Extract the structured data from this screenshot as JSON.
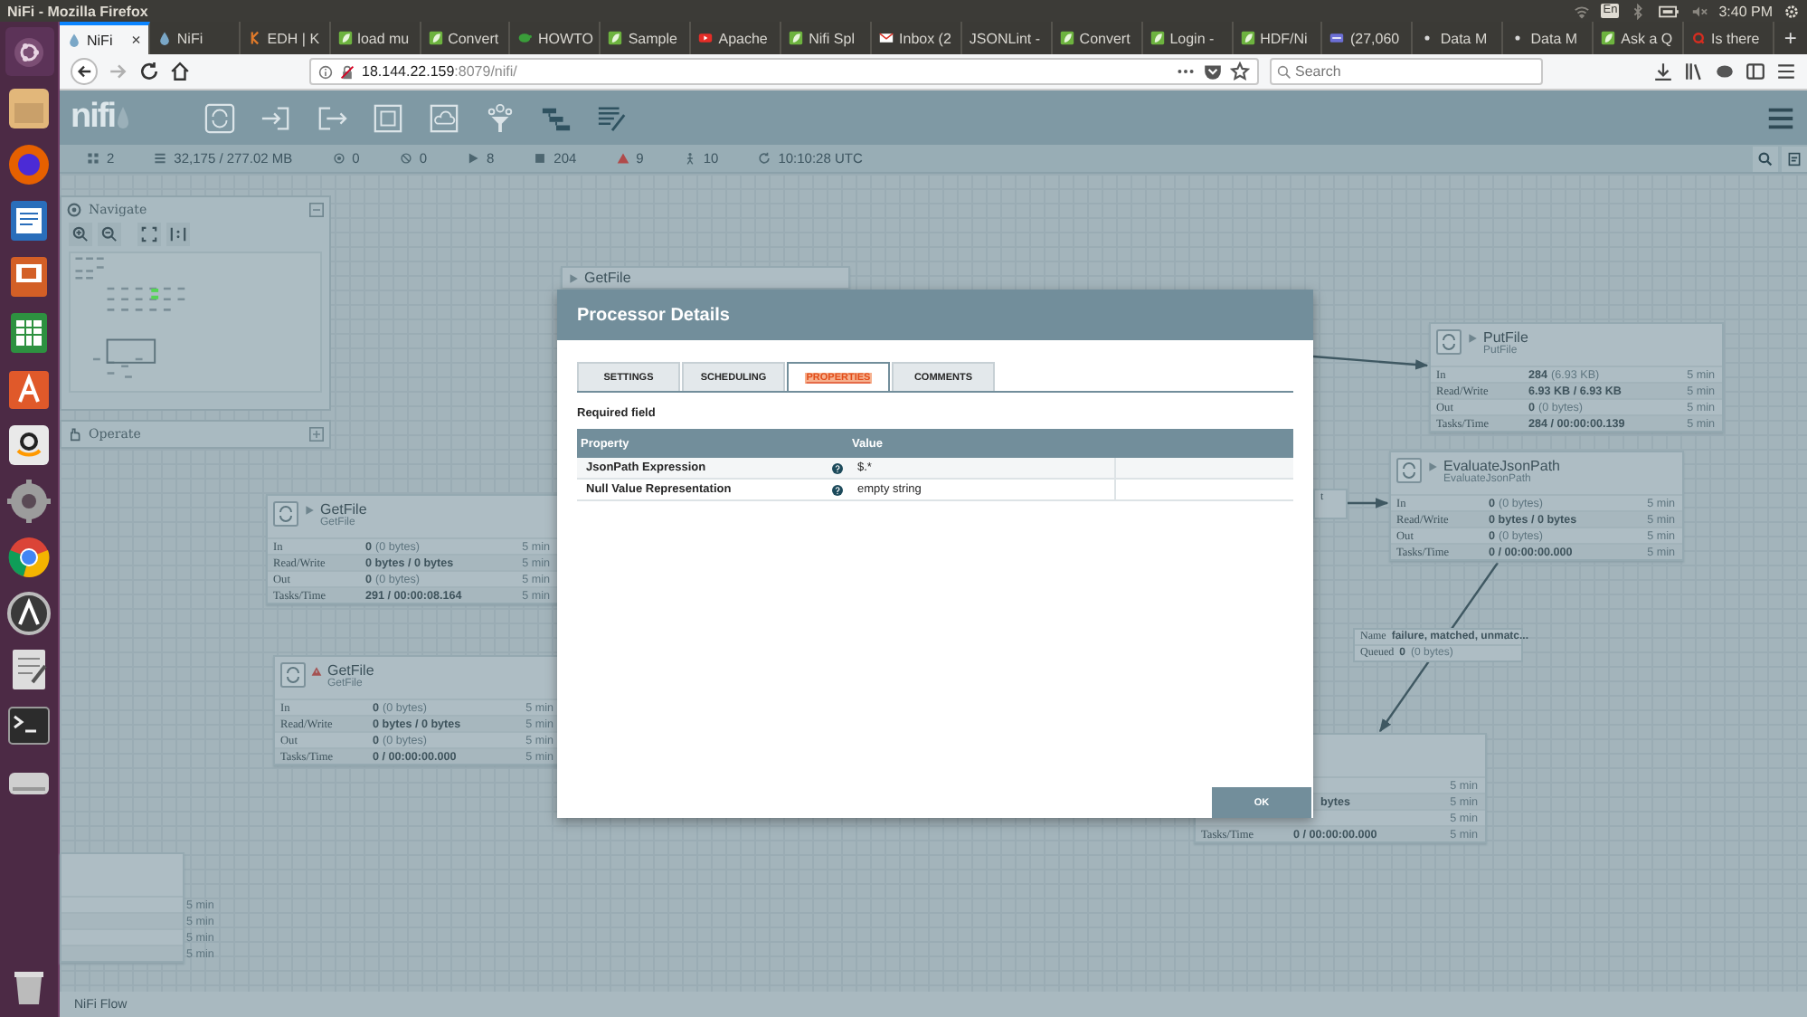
{
  "os_bar": {
    "title": "NiFi - Mozilla Firefox",
    "keyboard": "En",
    "clock": "3:40 PM"
  },
  "browser": {
    "tabs": [
      {
        "label": "NiFi",
        "kind": "drop",
        "selected": true
      },
      {
        "label": "NiFi",
        "kind": "drop",
        "selected": false
      },
      {
        "label": "EDH | K",
        "kind": "k",
        "selected": false
      },
      {
        "label": "load mu",
        "kind": "leaf",
        "selected": false
      },
      {
        "label": "Convert",
        "kind": "leaf",
        "selected": false
      },
      {
        "label": "HOWTO",
        "kind": "turtle",
        "selected": false
      },
      {
        "label": "Sample",
        "kind": "leaf",
        "selected": false
      },
      {
        "label": "Apache",
        "kind": "play",
        "selected": false
      },
      {
        "label": "Nifi Spl",
        "kind": "leaf",
        "selected": false
      },
      {
        "label": "Inbox (2",
        "kind": "mail",
        "selected": false
      },
      {
        "label": "JSONLint -",
        "kind": "none",
        "selected": false
      },
      {
        "label": "Convert",
        "kind": "leaf",
        "selected": false
      },
      {
        "label": "Login -",
        "kind": "leaf",
        "selected": false
      },
      {
        "label": "HDF/Ni",
        "kind": "leaf",
        "selected": false
      },
      {
        "label": "(27,060",
        "kind": "card",
        "selected": false
      },
      {
        "label": "Data M",
        "kind": "dot",
        "selected": false
      },
      {
        "label": "Data M",
        "kind": "dot",
        "selected": false
      },
      {
        "label": "Ask a Q",
        "kind": "leaf",
        "selected": false
      },
      {
        "label": "Is there",
        "kind": "q",
        "selected": false
      }
    ],
    "close_label": "×",
    "new_tab": "+",
    "url_host": "18.144.22.159",
    "url_path": ":8079/nifi/",
    "search": {
      "placeholder": "Search"
    }
  },
  "nifi": {
    "logo_text": "nifi",
    "status": [
      {
        "kind": "grid",
        "text": "2"
      },
      {
        "kind": "queue",
        "text": "32,175 / 277.02 MB"
      },
      {
        "kind": "transmitting",
        "text": "0"
      },
      {
        "kind": "not-transmitting",
        "text": "0"
      },
      {
        "kind": "running",
        "text": "8"
      },
      {
        "kind": "stopped",
        "text": "204"
      },
      {
        "kind": "invalid",
        "text": "9"
      },
      {
        "kind": "disabled",
        "text": "10"
      },
      {
        "kind": "refresh",
        "text": "10:10:28 UTC"
      }
    ],
    "navigate": {
      "title": "Navigate"
    },
    "operate": {
      "title": "Operate"
    },
    "processors": [
      {
        "kind": "header",
        "invalid": false,
        "title": "GetFile"
      },
      {
        "kind": "full",
        "invalid": false,
        "title": "GetFile",
        "subtitle": "GetFile",
        "rows": [
          {
            "label": "In",
            "value": "0",
            "detail": "(0 bytes)",
            "time": "5 min"
          },
          {
            "label": "Read/Write",
            "value": "0 bytes / 0 bytes",
            "time": "5 min"
          },
          {
            "label": "Out",
            "value": "0",
            "detail": "(0 bytes)",
            "time": "5 min"
          },
          {
            "label": "Tasks/Time",
            "value": "291 / 00:00:08.164",
            "time": "5 min"
          }
        ]
      },
      {
        "kind": "full",
        "invalid": true,
        "title": "GetFile",
        "subtitle": "GetFile",
        "rows": [
          {
            "label": "In",
            "value": "0",
            "detail": "(0 bytes)",
            "time": "5 min"
          },
          {
            "label": "Read/Write",
            "value": "0 bytes / 0 bytes",
            "time": "5 min"
          },
          {
            "label": "Out",
            "value": "0",
            "detail": "(0 bytes)",
            "time": "5 min"
          },
          {
            "label": "Tasks/Time",
            "value": "0 / 00:00:00.000",
            "time": "5 min"
          }
        ]
      },
      {
        "kind": "full",
        "invalid": false,
        "title": "PutFile",
        "subtitle": "PutFile",
        "rows": [
          {
            "label": "In",
            "value": "284",
            "detail": "(6.93 KB)",
            "time": "5 min"
          },
          {
            "label": "Read/Write",
            "value": "6.93 KB / 6.93 KB",
            "time": "5 min"
          },
          {
            "label": "Out",
            "value": "0",
            "detail": "(0 bytes)",
            "time": "5 min"
          },
          {
            "label": "Tasks/Time",
            "value": "284 / 00:00:00.139",
            "time": "5 min"
          }
        ]
      },
      {
        "kind": "full",
        "invalid": false,
        "title": "EvaluateJsonPath",
        "subtitle": "EvaluateJsonPath",
        "rows": [
          {
            "label": "In",
            "value": "0",
            "detail": "(0 bytes)",
            "time": "5 min"
          },
          {
            "label": "Read/Write",
            "value": "0 bytes / 0 bytes",
            "time": "5 min"
          },
          {
            "label": "Out",
            "value": "0",
            "detail": "(0 bytes)",
            "time": "5 min"
          },
          {
            "label": "Tasks/Time",
            "value": "0 / 00:00:00.000",
            "time": "5 min"
          }
        ]
      },
      {
        "kind": "partial",
        "rows": [
          {
            "time": "5 min"
          },
          {
            "time": "5 min"
          },
          {
            "time": "5 min"
          },
          {
            "time": "5 min"
          }
        ]
      },
      {
        "kind": "partial",
        "rows": [
          {
            "time": "5 min"
          },
          {
            "value": "bytes",
            "time": "5 min"
          },
          {
            "time": "5 min"
          },
          {
            "label": "Tasks/Time",
            "value": "0 / 00:00:00.000",
            "time": "5 min"
          }
        ]
      }
    ],
    "connection_labels": [
      {
        "kind": "partial",
        "text": "t"
      },
      {
        "kind": "full",
        "name_label": "Name",
        "name": "failure, matched, unmatc...",
        "queued_label": "Queued",
        "queued": "0",
        "queued_detail": "(0 bytes)"
      }
    ],
    "breadcrumb": "NiFi Flow"
  },
  "dialog": {
    "title": "Processor Details",
    "tabs": [
      {
        "label": "SETTINGS",
        "selected": false
      },
      {
        "label": "SCHEDULING",
        "selected": false
      },
      {
        "label": "PROPERTIES",
        "selected": true
      },
      {
        "label": "COMMENTS",
        "selected": false
      }
    ],
    "required_note": "Required field",
    "columns": [
      "Property",
      "Value"
    ],
    "rows": [
      {
        "property": "JsonPath Expression",
        "value": "$.*"
      },
      {
        "property": "Null Value Representation",
        "value": "empty string"
      }
    ],
    "ok": "OK"
  }
}
